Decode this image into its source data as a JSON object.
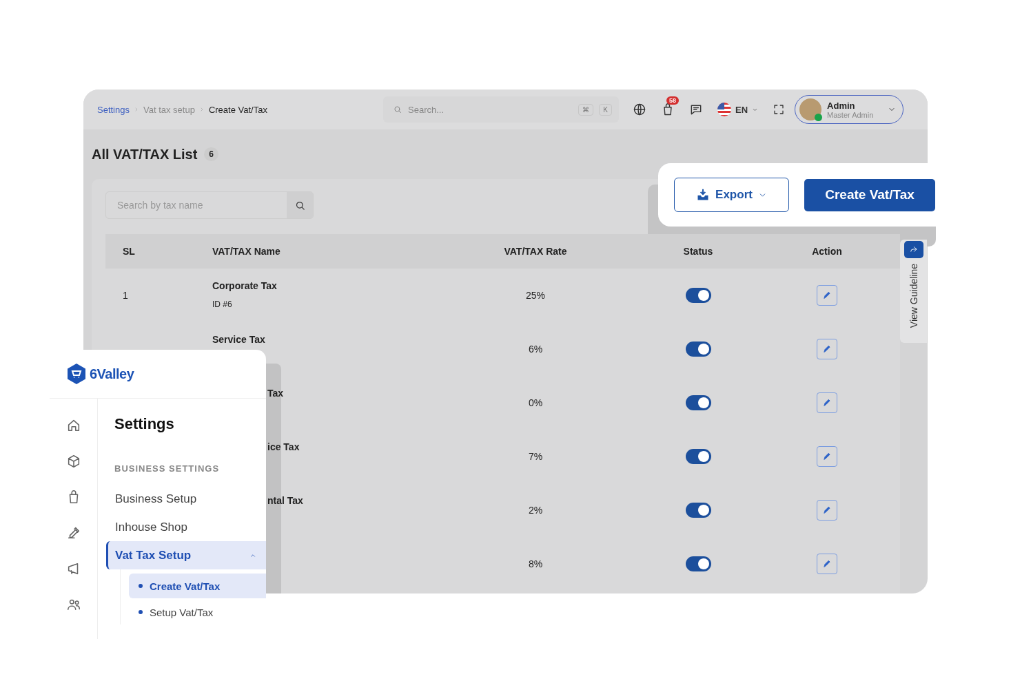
{
  "breadcrumb": [
    {
      "label": "Settings",
      "kind": "link"
    },
    {
      "label": "Vat tax setup",
      "kind": "muted"
    },
    {
      "label": "Create Vat/Tax",
      "kind": "current"
    }
  ],
  "search": {
    "placeholder": "Search...",
    "keys": [
      "⌘",
      "K"
    ]
  },
  "cart_badge": "58",
  "language": "EN",
  "user": {
    "name": "Admin",
    "role": "Master Admin"
  },
  "page": {
    "title": "All VAT/TAX List",
    "count": "6"
  },
  "table_search": {
    "placeholder": "Search by tax name"
  },
  "table": {
    "columns": [
      "SL",
      "VAT/TAX Name",
      "VAT/TAX Rate",
      "Status",
      "Action"
    ],
    "rows": [
      {
        "kind": "full",
        "sl": "1",
        "name": "Corporate Tax",
        "id": "ID #6",
        "rate": "25%",
        "on": true
      },
      {
        "kind": "full",
        "name": "Service Tax",
        "rate": "6%",
        "on": true
      },
      {
        "kind": "cropped",
        "name": "Tax",
        "rate": "0%",
        "on": true
      },
      {
        "kind": "cropped",
        "name": "ice Tax",
        "rate": "7%",
        "on": true
      },
      {
        "kind": "cropped",
        "name": "ntal Tax",
        "rate": "2%",
        "on": true
      },
      {
        "kind": "cropped",
        "rate": "8%",
        "on": true
      }
    ]
  },
  "actions": {
    "export": "Export",
    "create": "Create Vat/Tax"
  },
  "guideline": "View Guideline",
  "sidebar": {
    "logo": "6Valley",
    "heading": "Settings",
    "section": "BUSINESS SETTINGS",
    "items": [
      {
        "label": "Business Setup",
        "selected": false
      },
      {
        "label": "Inhouse Shop",
        "selected": false
      },
      {
        "label": "Vat Tax Setup",
        "selected": true,
        "expanded": true,
        "children": [
          {
            "label": "Create Vat/Tax",
            "selected": true
          },
          {
            "label": "Setup Vat/Tax",
            "selected": false
          }
        ]
      }
    ]
  }
}
